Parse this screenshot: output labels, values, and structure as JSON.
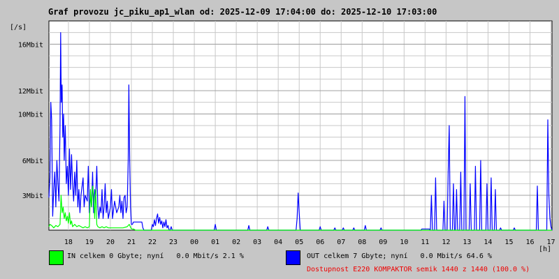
{
  "title": "Graf provozu jc_piku_ap1_wlan od: 2025-12-09 17:04:00 do: 2025-12-10 17:03:00",
  "legend": {
    "in": {
      "color": "#00ff00",
      "text": "IN celkem 0 Gbyte; nyní   0.0 Mbit/s 2.1 %"
    },
    "out": {
      "color": "#0000ff",
      "text": "OUT celkem 7 Gbyte; nyní   0.0 Mbit/s 64.6 %"
    }
  },
  "availability": {
    "text": "Dostupnost E220 KOMPAKTOR semik 1440 z 1440 (100.0 %)",
    "color": "#ee0000"
  },
  "chart_data": {
    "type": "line",
    "title": "Graf provozu jc_piku_ap1_wlan od: 2025-12-09 17:04:00 do: 2025-12-10 17:03:00",
    "ylabel": "[/s]",
    "xlabel": "[h]",
    "ylim": [
      0,
      18
    ],
    "xlim": [
      17.07,
      41.05
    ],
    "yticks": [
      {
        "v": 3,
        "label": "3Mbit"
      },
      {
        "v": 6,
        "label": "6Mbit"
      },
      {
        "v": 10,
        "label": "10Mbit"
      },
      {
        "v": 12,
        "label": "12Mbit"
      },
      {
        "v": 16,
        "label": "16Mbit"
      }
    ],
    "xticks": [
      {
        "v": 18,
        "label": "18"
      },
      {
        "v": 19,
        "label": "19"
      },
      {
        "v": 20,
        "label": "20"
      },
      {
        "v": 21,
        "label": "21"
      },
      {
        "v": 22,
        "label": "22"
      },
      {
        "v": 23,
        "label": "23"
      },
      {
        "v": 24,
        "label": "00"
      },
      {
        "v": 25,
        "label": "01"
      },
      {
        "v": 26,
        "label": "02"
      },
      {
        "v": 27,
        "label": "03"
      },
      {
        "v": 28,
        "label": "04"
      },
      {
        "v": 29,
        "label": "05"
      },
      {
        "v": 30,
        "label": "06"
      },
      {
        "v": 31,
        "label": "07"
      },
      {
        "v": 32,
        "label": "08"
      },
      {
        "v": 33,
        "label": "09"
      },
      {
        "v": 34,
        "label": "10"
      },
      {
        "v": 35,
        "label": "11"
      },
      {
        "v": 36,
        "label": "12"
      },
      {
        "v": 37,
        "label": "13"
      },
      {
        "v": 38,
        "label": "14"
      },
      {
        "v": 39,
        "label": "15"
      },
      {
        "v": 40,
        "label": "16"
      },
      {
        "v": 41,
        "label": "17"
      }
    ],
    "grid": true,
    "series": [
      {
        "name": "OUT",
        "color": "#0000ff",
        "points": [
          [
            17.07,
            2.8
          ],
          [
            17.12,
            4.5
          ],
          [
            17.16,
            11.0
          ],
          [
            17.2,
            9.5
          ],
          [
            17.25,
            1.2
          ],
          [
            17.3,
            3.5
          ],
          [
            17.35,
            5.0
          ],
          [
            17.4,
            2.0
          ],
          [
            17.45,
            6.0
          ],
          [
            17.5,
            4.0
          ],
          [
            17.55,
            2.5
          ],
          [
            17.6,
            9.0
          ],
          [
            17.63,
            17.0
          ],
          [
            17.66,
            11.0
          ],
          [
            17.7,
            12.5
          ],
          [
            17.73,
            8.0
          ],
          [
            17.77,
            10.0
          ],
          [
            17.8,
            6.0
          ],
          [
            17.85,
            9.0
          ],
          [
            17.9,
            4.0
          ],
          [
            17.95,
            5.5
          ],
          [
            18.0,
            3.0
          ],
          [
            18.05,
            7.0
          ],
          [
            18.1,
            3.5
          ],
          [
            18.15,
            6.5
          ],
          [
            18.2,
            4.0
          ],
          [
            18.25,
            2.5
          ],
          [
            18.3,
            5.0
          ],
          [
            18.35,
            3.0
          ],
          [
            18.4,
            6.0
          ],
          [
            18.45,
            2.0
          ],
          [
            18.5,
            3.5
          ],
          [
            18.55,
            1.5
          ],
          [
            18.6,
            3.0
          ],
          [
            18.7,
            4.5
          ],
          [
            18.75,
            2.0
          ],
          [
            18.8,
            3.0
          ],
          [
            18.9,
            2.5
          ],
          [
            18.95,
            5.5
          ],
          [
            19.0,
            1.5
          ],
          [
            19.05,
            3.0
          ],
          [
            19.1,
            2.0
          ],
          [
            19.15,
            5.0
          ],
          [
            19.2,
            1.5
          ],
          [
            19.25,
            3.5
          ],
          [
            19.3,
            3.0
          ],
          [
            19.35,
            5.5
          ],
          [
            19.4,
            2.0
          ],
          [
            19.45,
            1.0
          ],
          [
            19.5,
            2.0
          ],
          [
            19.55,
            1.5
          ],
          [
            19.6,
            3.5
          ],
          [
            19.65,
            1.0
          ],
          [
            19.7,
            2.0
          ],
          [
            19.75,
            4.0
          ],
          [
            19.8,
            1.5
          ],
          [
            19.85,
            2.5
          ],
          [
            19.9,
            1.0
          ],
          [
            19.95,
            1.5
          ],
          [
            20.0,
            2.0
          ],
          [
            20.05,
            3.5
          ],
          [
            20.1,
            1.0
          ],
          [
            20.2,
            2.5
          ],
          [
            20.3,
            1.5
          ],
          [
            20.4,
            2.0
          ],
          [
            20.45,
            3.0
          ],
          [
            20.5,
            1.5
          ],
          [
            20.55,
            2.5
          ],
          [
            20.6,
            1.0
          ],
          [
            20.65,
            2.8
          ],
          [
            20.7,
            3.0
          ],
          [
            20.75,
            1.5
          ],
          [
            20.8,
            2.0
          ],
          [
            20.85,
            6.0
          ],
          [
            20.88,
            12.5
          ],
          [
            20.92,
            6.0
          ],
          [
            20.96,
            2.0
          ],
          [
            21.0,
            0.5
          ],
          [
            21.05,
            0.5
          ],
          [
            21.1,
            0.7
          ],
          [
            21.3,
            0.7
          ],
          [
            21.5,
            0.7
          ],
          [
            21.55,
            0.2
          ],
          [
            21.6,
            0.0
          ],
          [
            21.95,
            0.0
          ],
          [
            22.0,
            0.5
          ],
          [
            22.05,
            0.3
          ],
          [
            22.1,
            0.9
          ],
          [
            22.15,
            0.4
          ],
          [
            22.2,
            1.0
          ],
          [
            22.25,
            1.4
          ],
          [
            22.3,
            0.6
          ],
          [
            22.35,
            1.1
          ],
          [
            22.4,
            0.5
          ],
          [
            22.45,
            0.8
          ],
          [
            22.5,
            0.2
          ],
          [
            22.55,
            0.7
          ],
          [
            22.6,
            0.3
          ],
          [
            22.65,
            0.9
          ],
          [
            22.7,
            0.2
          ],
          [
            22.75,
            0.4
          ],
          [
            22.8,
            0.0
          ],
          [
            22.85,
            0.0
          ],
          [
            22.9,
            0.3
          ],
          [
            22.95,
            0.0
          ],
          [
            24.95,
            0.0
          ],
          [
            25.0,
            0.5
          ],
          [
            25.05,
            0.0
          ],
          [
            26.55,
            0.0
          ],
          [
            26.6,
            0.4
          ],
          [
            26.65,
            0.0
          ],
          [
            27.45,
            0.0
          ],
          [
            27.5,
            0.3
          ],
          [
            27.55,
            0.0
          ],
          [
            28.85,
            0.0
          ],
          [
            28.9,
            1.0
          ],
          [
            28.95,
            3.2
          ],
          [
            29.0,
            1.5
          ],
          [
            29.05,
            0.0
          ],
          [
            29.95,
            0.0
          ],
          [
            30.0,
            0.3
          ],
          [
            30.05,
            0.0
          ],
          [
            30.65,
            0.0
          ],
          [
            30.7,
            0.2
          ],
          [
            30.75,
            0.0
          ],
          [
            31.05,
            0.0
          ],
          [
            31.1,
            0.2
          ],
          [
            31.15,
            0.0
          ],
          [
            31.55,
            0.0
          ],
          [
            31.6,
            0.2
          ],
          [
            31.65,
            0.0
          ],
          [
            32.1,
            0.0
          ],
          [
            32.15,
            0.4
          ],
          [
            32.2,
            0.0
          ],
          [
            32.85,
            0.0
          ],
          [
            32.9,
            0.2
          ],
          [
            32.95,
            0.0
          ],
          [
            34.8,
            0.0
          ],
          [
            34.85,
            0.1
          ],
          [
            35.2,
            0.1
          ],
          [
            35.25,
            0.0
          ],
          [
            35.3,
            3.0
          ],
          [
            35.35,
            0.0
          ],
          [
            35.45,
            0.0
          ],
          [
            35.5,
            4.5
          ],
          [
            35.55,
            0.0
          ],
          [
            35.85,
            0.0
          ],
          [
            35.9,
            2.5
          ],
          [
            35.95,
            0.0
          ],
          [
            36.05,
            0.0
          ],
          [
            36.1,
            5.0
          ],
          [
            36.15,
            9.0
          ],
          [
            36.2,
            0.0
          ],
          [
            36.3,
            0.0
          ],
          [
            36.35,
            4.0
          ],
          [
            36.4,
            0.0
          ],
          [
            36.45,
            0.0
          ],
          [
            36.5,
            3.5
          ],
          [
            36.55,
            0.0
          ],
          [
            36.65,
            0.0
          ],
          [
            36.7,
            5.0
          ],
          [
            36.75,
            0.0
          ],
          [
            36.85,
            0.0
          ],
          [
            36.9,
            11.5
          ],
          [
            36.95,
            0.0
          ],
          [
            37.1,
            0.0
          ],
          [
            37.15,
            4.0
          ],
          [
            37.2,
            0.0
          ],
          [
            37.35,
            0.0
          ],
          [
            37.4,
            5.5
          ],
          [
            37.45,
            0.0
          ],
          [
            37.6,
            0.0
          ],
          [
            37.65,
            6.0
          ],
          [
            37.7,
            0.0
          ],
          [
            37.9,
            0.0
          ],
          [
            37.95,
            4.0
          ],
          [
            38.0,
            0.0
          ],
          [
            38.1,
            0.0
          ],
          [
            38.15,
            4.5
          ],
          [
            38.2,
            0.0
          ],
          [
            38.3,
            0.0
          ],
          [
            38.35,
            3.5
          ],
          [
            38.4,
            0.0
          ],
          [
            38.55,
            0.0
          ],
          [
            38.6,
            0.2
          ],
          [
            38.65,
            0.0
          ],
          [
            39.2,
            0.0
          ],
          [
            39.25,
            0.2
          ],
          [
            39.3,
            0.0
          ],
          [
            40.3,
            0.0
          ],
          [
            40.35,
            3.8
          ],
          [
            40.4,
            0.0
          ],
          [
            40.8,
            0.0
          ],
          [
            40.85,
            9.5
          ],
          [
            40.9,
            3.0
          ],
          [
            40.95,
            1.0
          ],
          [
            41.0,
            0.3
          ],
          [
            41.05,
            0.0
          ]
        ]
      },
      {
        "name": "IN",
        "color": "#00ff00",
        "points": [
          [
            17.07,
            0.3
          ],
          [
            17.12,
            0.5
          ],
          [
            17.2,
            0.4
          ],
          [
            17.3,
            0.2
          ],
          [
            17.4,
            0.4
          ],
          [
            17.5,
            0.3
          ],
          [
            17.6,
            0.5
          ],
          [
            17.65,
            3.0
          ],
          [
            17.7,
            1.5
          ],
          [
            17.75,
            2.0
          ],
          [
            17.8,
            1.0
          ],
          [
            17.85,
            1.5
          ],
          [
            17.9,
            0.8
          ],
          [
            17.95,
            1.2
          ],
          [
            18.0,
            0.6
          ],
          [
            18.05,
            1.5
          ],
          [
            18.1,
            0.5
          ],
          [
            18.15,
            0.8
          ],
          [
            18.2,
            0.3
          ],
          [
            18.3,
            0.5
          ],
          [
            18.4,
            0.3
          ],
          [
            18.5,
            0.4
          ],
          [
            18.6,
            0.3
          ],
          [
            18.7,
            0.2
          ],
          [
            18.8,
            0.3
          ],
          [
            18.9,
            0.2
          ],
          [
            19.0,
            0.3
          ],
          [
            19.05,
            3.5
          ],
          [
            19.1,
            2.0
          ],
          [
            19.15,
            3.8
          ],
          [
            19.2,
            3.0
          ],
          [
            19.25,
            1.0
          ],
          [
            19.3,
            3.5
          ],
          [
            19.35,
            0.5
          ],
          [
            19.4,
            0.3
          ],
          [
            19.5,
            0.2
          ],
          [
            19.6,
            0.3
          ],
          [
            19.7,
            0.2
          ],
          [
            19.8,
            0.3
          ],
          [
            19.9,
            0.2
          ],
          [
            20.0,
            0.2
          ],
          [
            20.2,
            0.2
          ],
          [
            20.4,
            0.2
          ],
          [
            20.6,
            0.2
          ],
          [
            20.8,
            0.3
          ],
          [
            20.9,
            0.5
          ],
          [
            21.0,
            0.1
          ],
          [
            21.1,
            0.1
          ],
          [
            21.2,
            0.0
          ],
          [
            41.05,
            0.0
          ]
        ]
      }
    ]
  }
}
